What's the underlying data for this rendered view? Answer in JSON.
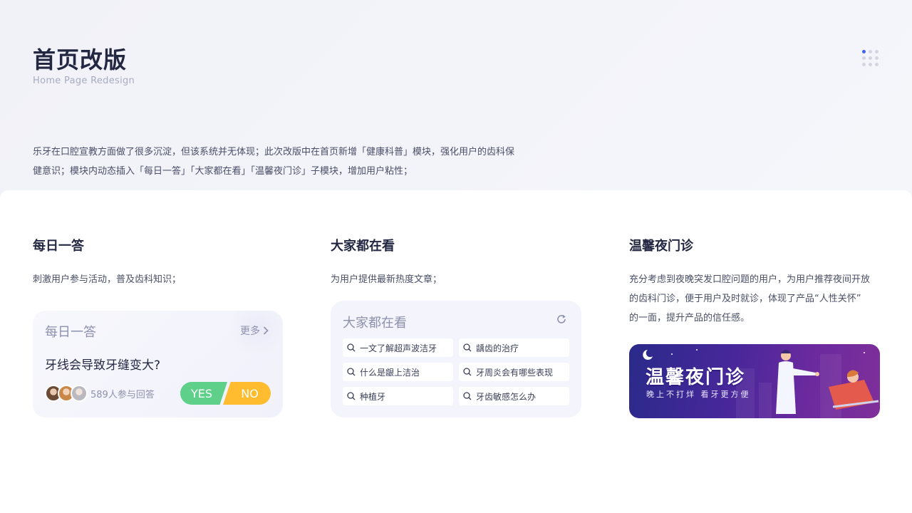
{
  "header": {
    "title": "首页改版",
    "subtitle": "Home Page Redesign"
  },
  "intro": {
    "line1": "乐牙在口腔宣教方面做了很多沉淀，但该系统并无体现；此次改版中在首页新增「健康科普」模块，强化用户的齿科保",
    "line2": "健意识；模块内动态插入「每日一答」「大家都在看」「温馨夜门诊」子模块，增加用户粘性；"
  },
  "sections": [
    {
      "title": "每日一答",
      "desc": "刺激用户参与活动，普及齿科知识；"
    },
    {
      "title": "大家都在看",
      "desc": "为用户提供最新热度文章；"
    },
    {
      "title": "温馨夜门诊",
      "desc_lines": [
        "充分考虑到夜晚突发口腔问题的用户，为用户推荐夜间开放",
        "的齿科门诊，便于用户及时就诊，体现了产品“人性关怀”",
        "的一面，提升产品的信任感。"
      ]
    }
  ],
  "daily_card": {
    "title": "每日一答",
    "more": "更多",
    "question": "牙线会导致牙缝变大?",
    "participants": "589人参与回答",
    "yes": "YES",
    "no": "NO"
  },
  "popular_card": {
    "title": "大家都在看",
    "items": [
      "一文了解超声波洁牙",
      "龋齿的治疗",
      "什么是龈上洁治",
      "牙周炎会有哪些表现",
      "种植牙",
      "牙齿敏感怎么办"
    ]
  },
  "banner": {
    "title": "温馨夜门诊",
    "subtitle": "晚上不打烊 看牙更方便"
  },
  "colors": {
    "accent": "#3e63f0",
    "yes": "#5fd08a",
    "no": "#ffbc2f",
    "banner_start": "#2a2a8a",
    "banner_end": "#7f2f9a"
  },
  "icons": {
    "more": "chevron-right-icon",
    "refresh": "refresh-icon",
    "search": "search-icon",
    "menu": "grid-dots-icon"
  }
}
